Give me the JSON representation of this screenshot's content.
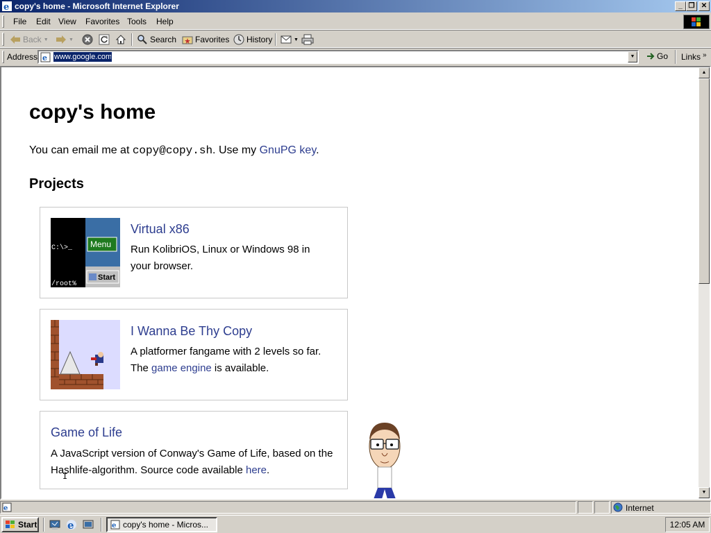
{
  "window": {
    "title": "copy's home - Microsoft Internet Explorer",
    "min_glyph": "_",
    "max_glyph": "❐",
    "close_glyph": "✕"
  },
  "menubar": {
    "items": [
      "File",
      "Edit",
      "View",
      "Favorites",
      "Tools",
      "Help"
    ]
  },
  "toolbar": {
    "back": "Back",
    "search": "Search",
    "favorites": "Favorites",
    "history": "History"
  },
  "address": {
    "label": "Address",
    "value": "www.google.com",
    "go": "Go",
    "links": "Links",
    "links_chevron": "»"
  },
  "page": {
    "title": "copy's home",
    "intro_prefix": "You can email me at ",
    "email": "copy@copy.sh",
    "intro_middle": ". Use my ",
    "gnupg_link": "GnuPG key",
    "intro_suffix": ".",
    "projects_heading": "Projects",
    "projects": [
      {
        "title": "Virtual x86",
        "desc": "Run KolibriOS, Linux or Windows 98 in your browser.",
        "thumb_prompt": "C:\\>_",
        "thumb_root": "/root%",
        "thumb_menu": "Menu",
        "thumb_start": "Start"
      },
      {
        "title": "I Wanna Be Thy Copy",
        "desc_prefix": "A platformer fangame with 2 levels so far. The ",
        "desc_link": "game engine",
        "desc_suffix": " is available."
      },
      {
        "title": "Game of Life",
        "desc_prefix": "A JavaScript version of Conway's Game of Life, based on the Hashlife-algorithm. Source code available ",
        "desc_link": "here",
        "desc_suffix": "."
      }
    ]
  },
  "status": {
    "zone": "Internet"
  },
  "taskbar": {
    "start": "Start",
    "task": "copy's home - Micros...",
    "clock": "12:05 AM"
  },
  "colors": {
    "link": "#2d3d8f",
    "titlebar_start": "#0a246a",
    "titlebar_end": "#a6caf0",
    "chrome": "#d4d0c8"
  }
}
